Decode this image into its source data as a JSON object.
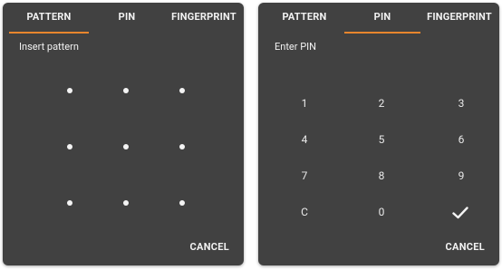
{
  "pattern_dialog": {
    "tabs": [
      "PATTERN",
      "PIN",
      "FINGERPRINT"
    ],
    "active_tab": "PATTERN",
    "prompt": "Insert pattern",
    "cancel_label": "CANCEL"
  },
  "pin_dialog": {
    "tabs": [
      "PATTERN",
      "PIN",
      "FINGERPRINT"
    ],
    "active_tab": "PIN",
    "prompt": "Enter PIN",
    "keys": [
      "1",
      "2",
      "3",
      "4",
      "5",
      "6",
      "7",
      "8",
      "9",
      "C",
      "0"
    ],
    "confirm_icon": "checkmark-icon",
    "cancel_label": "CANCEL"
  },
  "colors": {
    "dialog_bg": "#414141",
    "accent": "#e8862d",
    "text": "#f2f2f2"
  }
}
